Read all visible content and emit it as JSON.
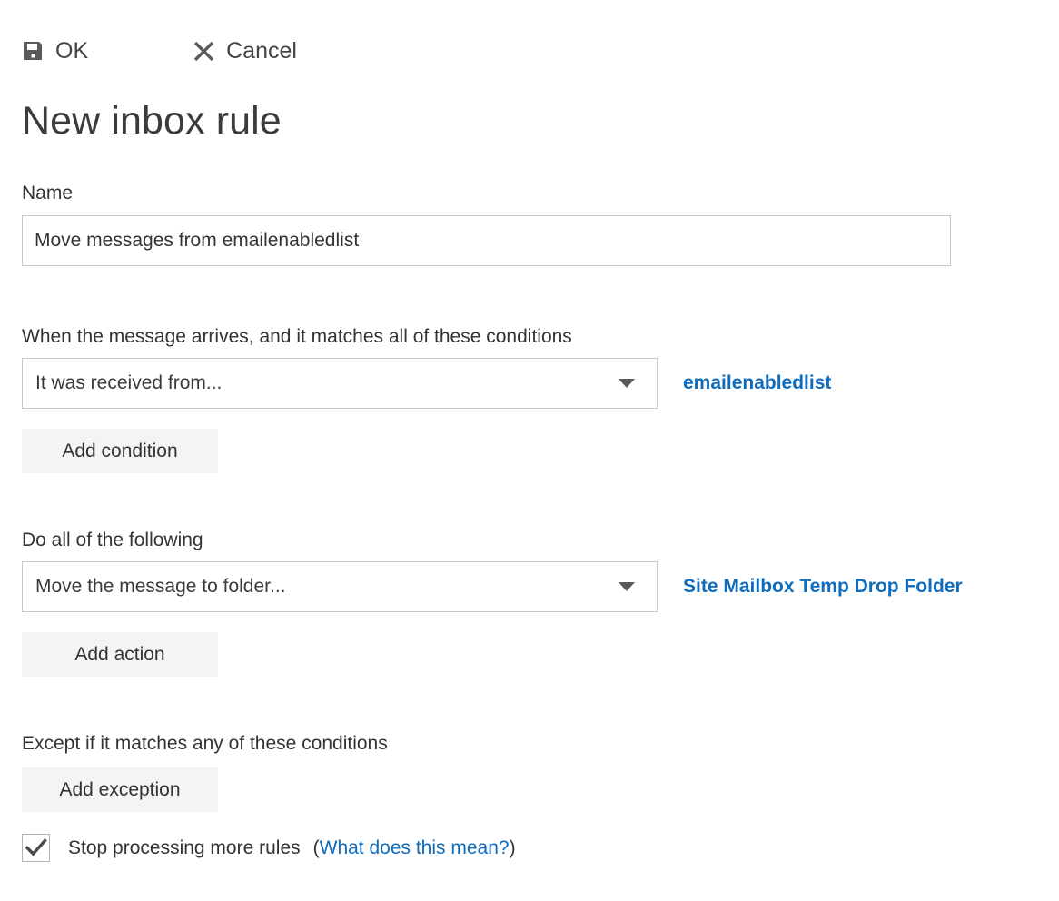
{
  "toolbar": {
    "ok": {
      "label": "OK",
      "icon": "save-icon"
    },
    "cancel": {
      "label": "Cancel",
      "icon": "close-icon"
    }
  },
  "header": {
    "title": "New inbox rule"
  },
  "name_field": {
    "label": "Name",
    "value": "Move messages from emailenabledlist",
    "placeholder": "Name"
  },
  "conditions": {
    "label": "When the message arrives, and it matches all of these conditions",
    "select_value": "It was received from...",
    "value_link": "emailenabledlist",
    "add_button": "Add condition"
  },
  "actions": {
    "label": "Do all of the following",
    "select_value": "Move the message to folder...",
    "value_link": "Site Mailbox Temp Drop Folder",
    "add_button": "Add action"
  },
  "exceptions": {
    "label": "Except if it matches any of these conditions",
    "add_button": "Add exception"
  },
  "stop_processing": {
    "label": "Stop processing more rules",
    "checked": true,
    "help_open": "(",
    "help_link": "What does this mean?",
    "help_close": ")"
  },
  "colors": {
    "link": "#0f6cbd",
    "text": "#333333",
    "border": "#c8c8c8",
    "button_bg": "#f4f4f4",
    "icon": "#5a5a5a"
  }
}
